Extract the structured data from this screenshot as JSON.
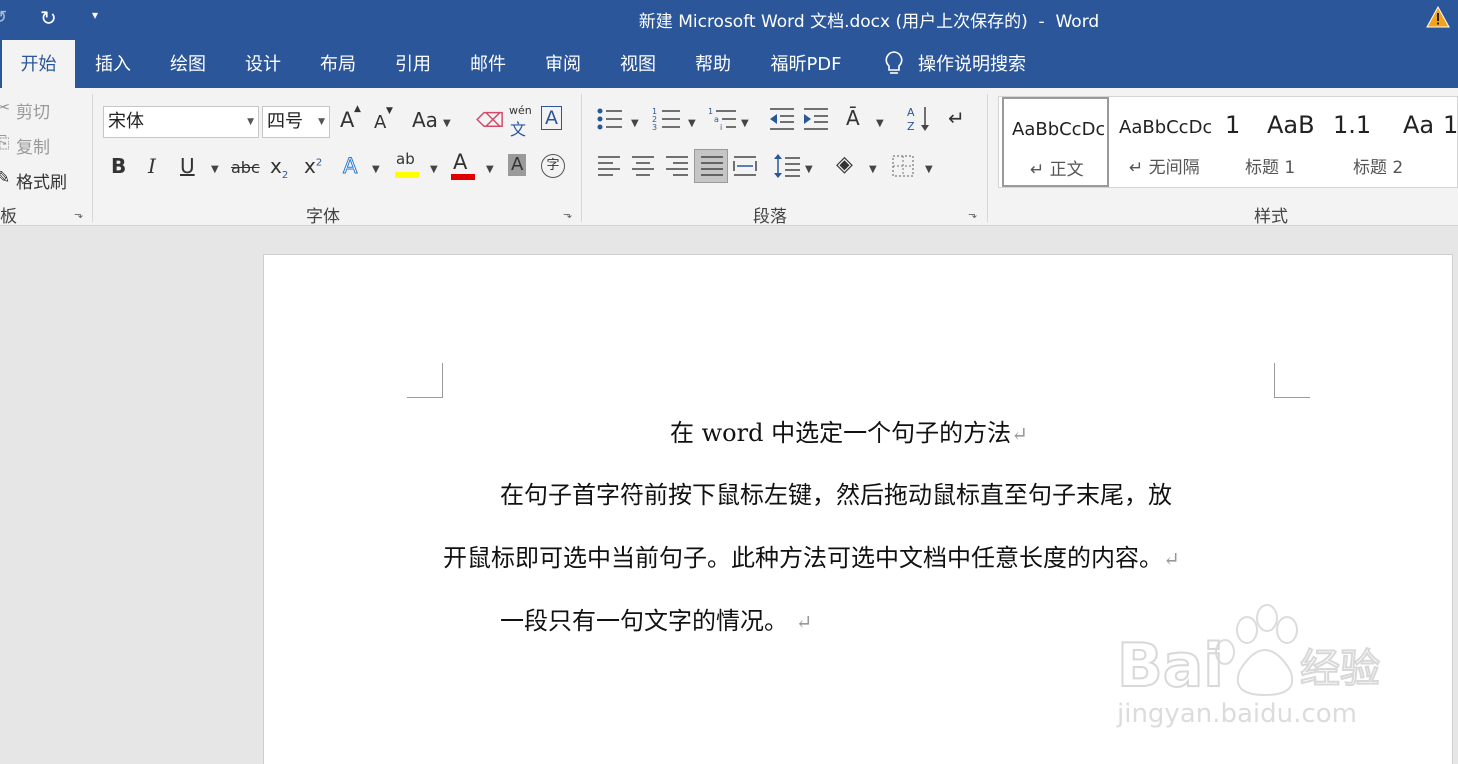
{
  "titlebar": {
    "title": "新建 Microsoft Word 文档.docx (用户上次保存的)  -  Word"
  },
  "tabs": [
    "开始",
    "插入",
    "绘图",
    "设计",
    "布局",
    "引用",
    "邮件",
    "审阅",
    "视图",
    "帮助",
    "福昕PDF"
  ],
  "tell_me": "操作说明搜索",
  "clipboard": {
    "cut": "剪切",
    "copy": "复制",
    "format_painter": "格式刷",
    "label": "板"
  },
  "font": {
    "name": "宋体",
    "size": "四号",
    "label": "字体",
    "grow": "A",
    "shrink": "A",
    "case": "Aa",
    "pinyin_top": "wén",
    "pinyin_bottom": "文",
    "border": "A",
    "bold": "B",
    "italic": "I",
    "underline": "U",
    "strike": "abc",
    "sub": "x",
    "sub_mark": "2",
    "sup": "x",
    "sup_mark": "2",
    "effects": "A",
    "highlight": "ab",
    "color": "A",
    "shade": "A",
    "enclose": "字",
    "highlight_color": "#ffff00",
    "font_color": "#e00000"
  },
  "paragraph": {
    "label": "段落"
  },
  "styles": {
    "label": "样式",
    "items": [
      {
        "sample": "AaBbCcDc",
        "name": "↵ 正文"
      },
      {
        "sample": "AaBbCcDc",
        "name": "↵ 无间隔"
      },
      {
        "sample": "1",
        "name": ""
      },
      {
        "sample": "AaB",
        "name": "标题 1"
      },
      {
        "sample": "1.1",
        "name": ""
      },
      {
        "sample": "Aa",
        "name": "标题 2"
      },
      {
        "sample": "1",
        "name": ""
      }
    ]
  },
  "document": {
    "title": "在 word 中选定一个句子的方法",
    "p1_line1": "在句子首字符前按下鼠标左键，然后拖动鼠标直至句子末尾，放",
    "p1_line2": "开鼠标即可选中当前句子。此种方法可选中文档中任意长度的内容。",
    "p2": "一段只有一句文字的情况。",
    "para_mark": "↵"
  },
  "watermark": {
    "text": "Bai du 经验",
    "url_text": "jingyan.baidu.com"
  },
  "colors": {
    "accent": "#2b579a"
  }
}
